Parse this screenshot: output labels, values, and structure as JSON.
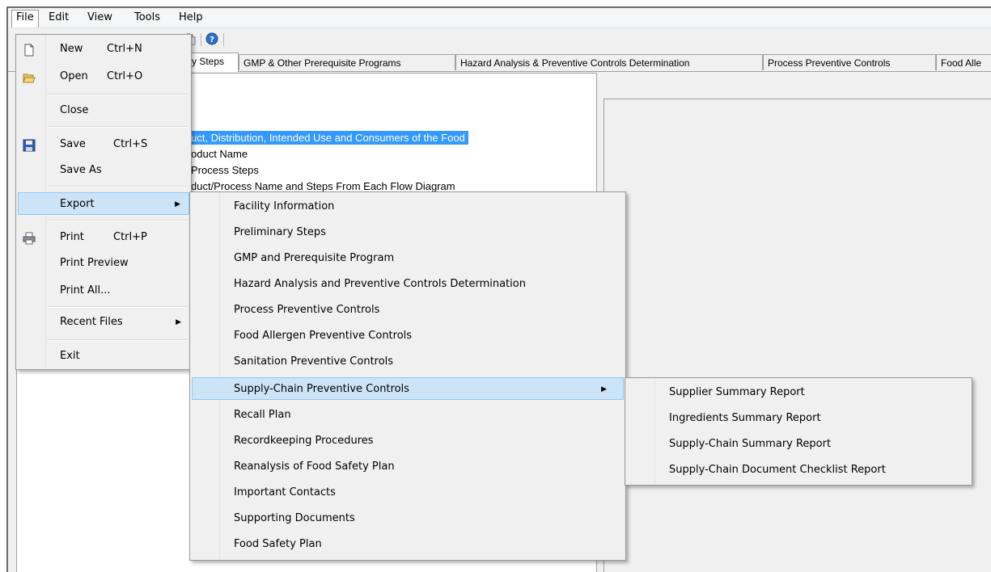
{
  "menubar": {
    "items": [
      "File",
      "Edit",
      "View",
      "Tools",
      "Help"
    ]
  },
  "tabs": {
    "items": [
      "y Steps",
      "GMP & Other Prerequisite Programs",
      "Hazard Analysis & Preventive Controls Determination",
      "Process Preventive Controls",
      "Food Alle"
    ]
  },
  "tree": {
    "lines": [
      "uct, Distribution, Intended Use and Consumers of the Food",
      "oduct Name",
      "Process Steps",
      "duct/Process Name and Steps From Each Flow Diagram"
    ]
  },
  "file_menu": {
    "new": {
      "label": "New",
      "shortcut": "Ctrl+N",
      "icon": "new-document-icon"
    },
    "open": {
      "label": "Open",
      "shortcut": "Ctrl+O",
      "icon": "open-folder-icon"
    },
    "close": {
      "label": "Close"
    },
    "save": {
      "label": "Save",
      "shortcut": "Ctrl+S",
      "icon": "floppy-disk-icon"
    },
    "save_as": {
      "label": "Save As"
    },
    "export": {
      "label": "Export"
    },
    "print": {
      "label": "Print",
      "shortcut": "Ctrl+P",
      "icon": "printer-icon"
    },
    "print_preview": {
      "label": "Print Preview"
    },
    "print_all": {
      "label": "Print All..."
    },
    "recent_files": {
      "label": "Recent Files"
    },
    "exit": {
      "label": "Exit"
    }
  },
  "export_menu": {
    "items": [
      "Facility Information",
      "Preliminary Steps",
      "GMP and Prerequisite Program",
      "Hazard Analysis and Preventive Controls Determination",
      "Process Preventive Controls",
      "Food Allergen Preventive Controls",
      "Sanitation Preventive Controls",
      "Supply-Chain Preventive Controls",
      "Recall Plan",
      "Recordkeeping Procedures",
      "Reanalysis of Food Safety Plan",
      "Important Contacts",
      "Supporting Documents",
      "Food Safety Plan"
    ]
  },
  "supply_chain_menu": {
    "items": [
      "Supplier Summary Report",
      "Ingredients Summary Report",
      "Supply-Chain Summary Report",
      "Supply-Chain Document Checklist Report"
    ]
  },
  "colors": {
    "highlight": "#cce4f7",
    "highlight_border": "#90c8f6",
    "selection": "#3399ff"
  }
}
